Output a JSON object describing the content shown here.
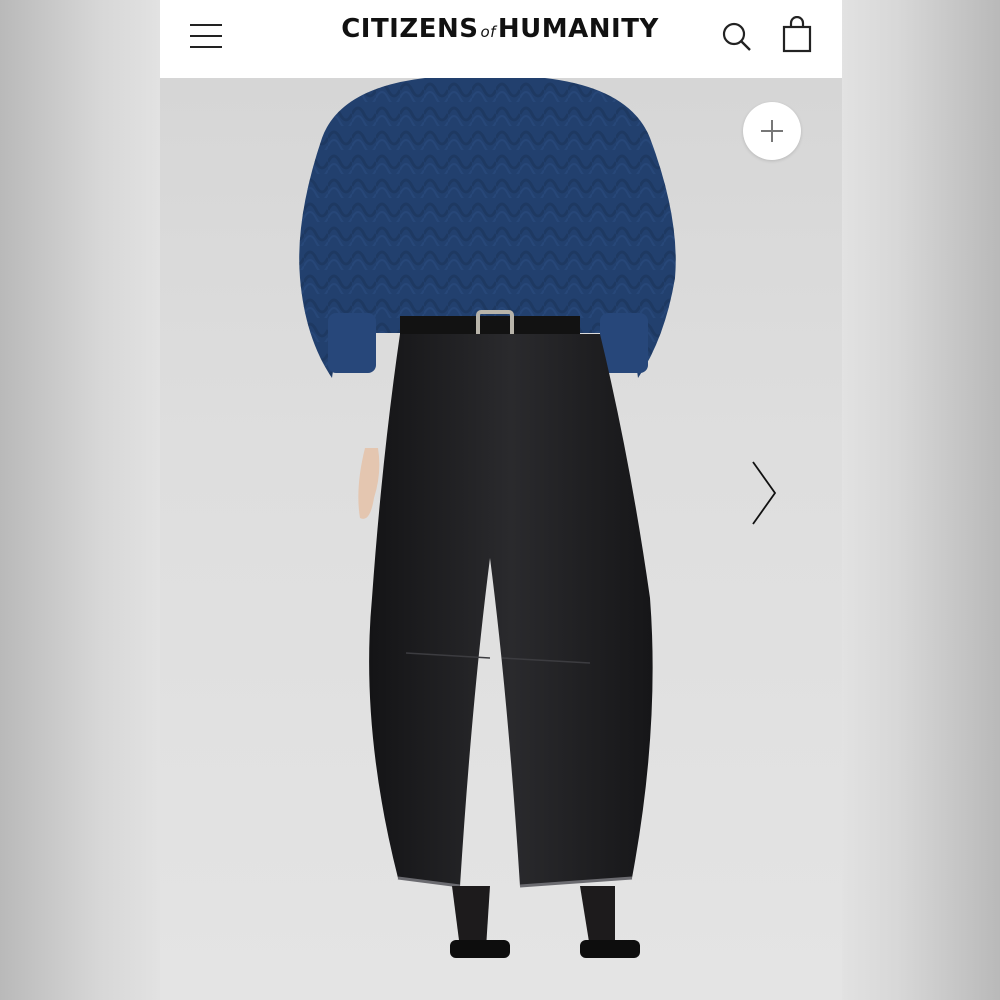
{
  "header": {
    "brand_left": "CITIZENS",
    "brand_of": "of",
    "brand_right": "HUMANITY",
    "menu_icon": "hamburger-menu-icon",
    "search_icon": "search-icon",
    "bag_icon": "shopping-bag-icon"
  },
  "hero": {
    "zoom_icon": "plus-icon",
    "next_icon": "chevron-right-icon",
    "colors": {
      "sweater": "#22406e",
      "jeans": "#1c1c1e",
      "skin": "#e4c6b0",
      "background": "#dedede"
    }
  }
}
